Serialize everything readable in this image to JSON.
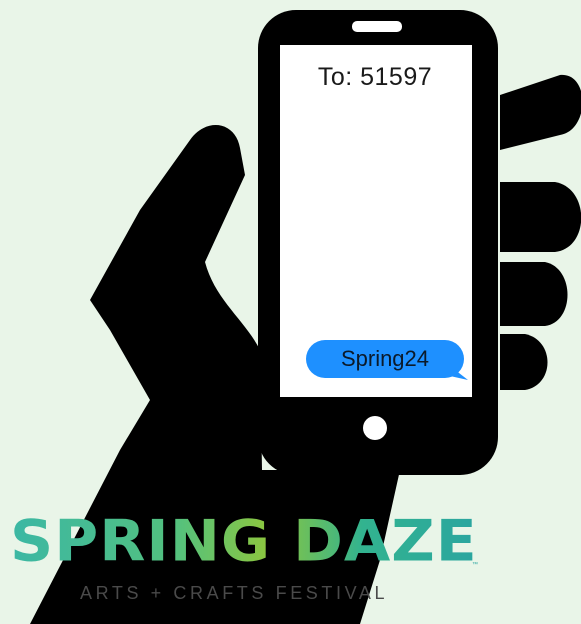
{
  "message": {
    "recipient": "To: 51597",
    "text": "Spring24"
  },
  "logo": {
    "title": "SPRING DAZE",
    "trademark": "™",
    "subtitle": "ARTS + CRAFTS FESTIVAL"
  },
  "colors": {
    "background": "#e9f5e8",
    "silhouette": "#000000",
    "bubble": "#1e90ff",
    "logo_gradient": [
      "#3bb7a4",
      "#8cc63f",
      "#2aa5a0"
    ]
  }
}
